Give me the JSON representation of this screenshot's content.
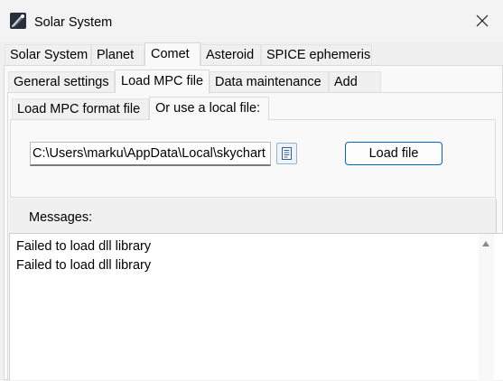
{
  "window": {
    "title": "Solar System"
  },
  "main_tabs": [
    {
      "label": "Solar System"
    },
    {
      "label": "Planet"
    },
    {
      "label": "Comet"
    },
    {
      "label": "Asteroid"
    },
    {
      "label": "SPICE ephemeris"
    }
  ],
  "comet_tabs": [
    {
      "label": "General settings"
    },
    {
      "label": "Load MPC file"
    },
    {
      "label": "Data maintenance"
    },
    {
      "label": "Add"
    }
  ],
  "load_tabs": [
    {
      "label": "Load MPC format file"
    },
    {
      "label": "Or use a local file:"
    }
  ],
  "local_file": {
    "path_value": "C:\\Users\\marku\\AppData\\Local\\skychart",
    "load_button": "Load file"
  },
  "messages": {
    "label": "Messages:",
    "lines": [
      "Failed to load dll library",
      "Failed to load dll library"
    ]
  },
  "icons": {
    "app": "comet-icon",
    "close": "close-icon",
    "browse": "document-icon"
  },
  "colors": {
    "button_border": "#0067c0",
    "background": "#f0f0f0"
  }
}
